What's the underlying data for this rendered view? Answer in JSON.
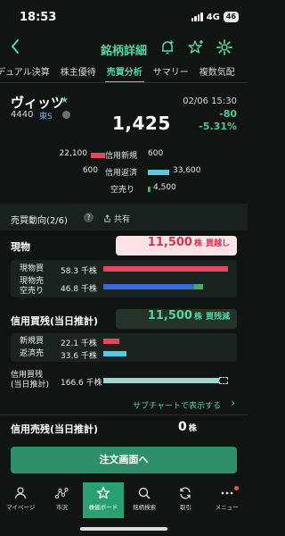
{
  "status": {
    "time": "18:53",
    "network": "4G",
    "battery": "46"
  },
  "nav": {
    "title": "銘柄詳細"
  },
  "tabs": [
    "デュアル決算",
    "株主優待",
    "売買分析",
    "サマリー",
    "複数気配"
  ],
  "stock": {
    "name": "ヴィッツ",
    "code": "4440",
    "market": "東S",
    "price": "1,425",
    "datetime": "02/06 15:30",
    "change": "-80",
    "change_pct": "-5.31%"
  },
  "mini": {
    "shinyo_shinki": {
      "left_value": "22,100",
      "label": "信用新規",
      "right_value": "600",
      "left_ratio": 0.66,
      "right_ratio": 0.0
    },
    "shinyo_hensai": {
      "left_value": "600",
      "label": "信用返済",
      "right_value": "33,600",
      "left_ratio": 0.0,
      "right_ratio": 1.0
    },
    "karauri": {
      "label": "空売り",
      "right_value": "4,500",
      "right_ratio": 0.0
    }
  },
  "trend": {
    "title": "売買動向(2/6)",
    "help": "?",
    "share_label": "共有"
  },
  "genbutsu": {
    "title": "現物",
    "pill_value": "11,500",
    "pill_unit": "株",
    "pill_status": "買越し",
    "rows": [
      {
        "label": "現物買",
        "value": "58.3",
        "unit": "千株",
        "ratio": 1.0
      },
      {
        "label": "現物売\n空売り",
        "value": "46.8",
        "unit": "千株",
        "ratio": 0.8,
        "sub_ratio": 0.08
      }
    ]
  },
  "shinyo_kaizan": {
    "title": "信用買残(当日推計)",
    "pill_value": "11,500",
    "pill_unit": "株",
    "pill_status": "買残減",
    "rows": [
      {
        "label": "新規買",
        "value": "22.1",
        "unit": "千株",
        "ratio": 0.13
      },
      {
        "label": "返済売",
        "value": "33.6",
        "unit": "千株",
        "ratio": 0.19
      },
      {
        "label": "信用買残\n(当日推計)",
        "value": "166.6",
        "unit": "千株",
        "ratio": 0.96
      }
    ],
    "subchart_label": "サブチャートで表示する"
  },
  "shinyo_urizan": {
    "title": "信用売残(当日推計)",
    "value": "0",
    "unit": "株"
  },
  "order_button": "注文画面へ",
  "bottom_nav": [
    {
      "label": "マイページ",
      "icon": "person-icon"
    },
    {
      "label": "市況",
      "icon": "network-icon"
    },
    {
      "label": "株価ボード",
      "icon": "star-icon"
    },
    {
      "label": "銘柄検索",
      "icon": "search-icon"
    },
    {
      "label": "取引",
      "icon": "refresh-icon"
    },
    {
      "label": "メニュー",
      "icon": "dots-icon"
    }
  ],
  "colors": {
    "accent": "#52d6a3",
    "buy": "#e8455f",
    "sell_blue": "#3a6bd8",
    "sell_green": "#3fb15d",
    "cyan": "#5cc8e6",
    "negative": "#4ec98a",
    "order_button": "#2f8f6b"
  }
}
